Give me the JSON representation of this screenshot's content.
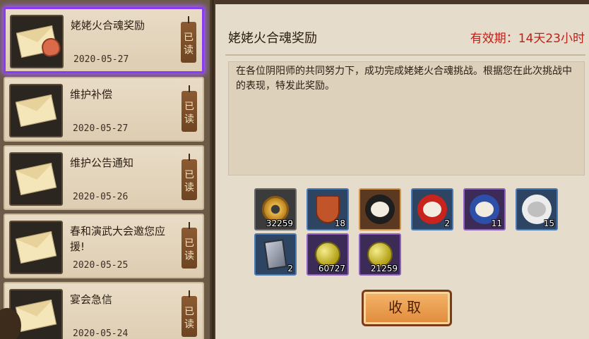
{
  "mail_list": [
    {
      "title": "姥姥火合魂奖励",
      "date": "2020-05-27",
      "status": "已读",
      "selected": true
    },
    {
      "title": "维护补偿",
      "date": "2020-05-27",
      "status": "已读",
      "selected": false
    },
    {
      "title": "维护公告通知",
      "date": "2020-05-26",
      "status": "已读",
      "selected": false
    },
    {
      "title": "春和演武大会邀您应援!",
      "date": "2020-05-25",
      "status": "已读",
      "selected": false
    },
    {
      "title": "宴会急信",
      "date": "2020-05-24",
      "status": "已读",
      "selected": false
    }
  ],
  "detail": {
    "title": "姥姥火合魂奖励",
    "expiry": "有效期：14天23小时",
    "body": "在各位阴阳师的共同努力下，成功完成姥姥火合魂挑战。根据您在此次挑战中的表现，特发此奖励。"
  },
  "rewards": [
    {
      "name": "gold-coin-icon",
      "qty": "32259"
    },
    {
      "name": "medal-icon",
      "qty": "18"
    },
    {
      "name": "black-daruma-icon",
      "qty": ""
    },
    {
      "name": "red-daruma-icon",
      "qty": "2"
    },
    {
      "name": "blue-daruma-icon",
      "qty": "11"
    },
    {
      "name": "white-daruma-icon",
      "qty": "15"
    },
    {
      "name": "card-icon",
      "qty": "2"
    },
    {
      "name": "jade-icon",
      "qty": "60727"
    },
    {
      "name": "jade-icon",
      "qty": "21259"
    }
  ],
  "claim_label": "收取",
  "colors": {
    "expiry": "#b8221a",
    "selected_border": "#8a3cf0"
  }
}
